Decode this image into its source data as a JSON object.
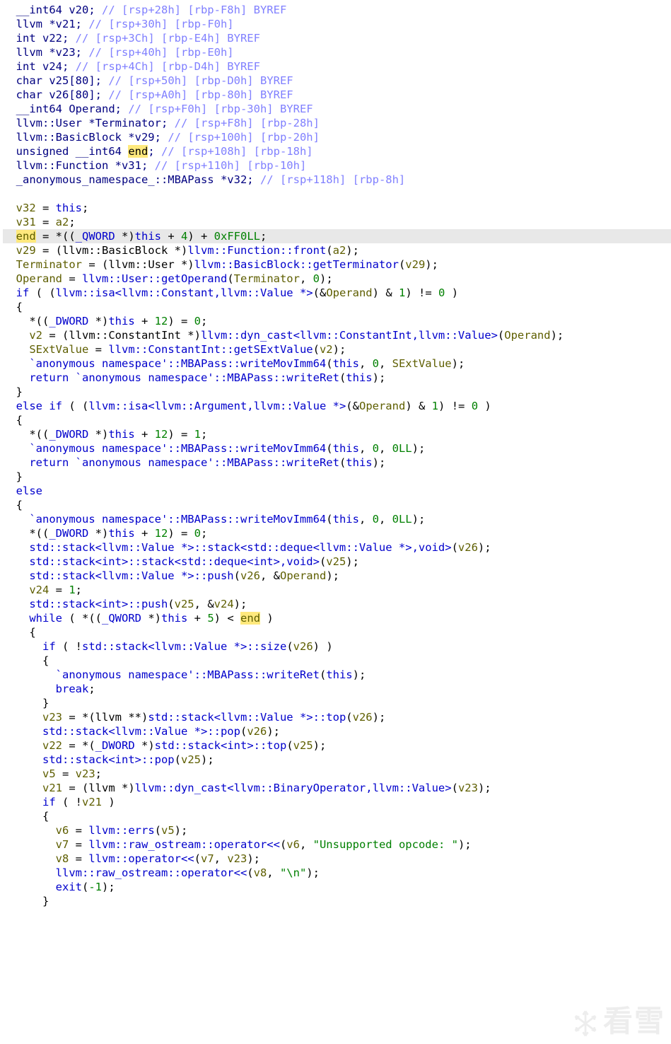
{
  "decl": {
    "v20": "__int64 v20;",
    "v20c": "// [rsp+28h] [rbp-F8h] BYREF",
    "v21": "llvm *v21;",
    "v21c": "// [rsp+30h] [rbp-F0h]",
    "v22": "int v22;",
    "v22c": "// [rsp+3Ch] [rbp-E4h] BYREF",
    "v23": "llvm *v23;",
    "v23c": "// [rsp+40h] [rbp-E0h]",
    "v24": "int v24;",
    "v24c": "// [rsp+4Ch] [rbp-D4h] BYREF",
    "v25": "char v25[80];",
    "v25c": "// [rsp+50h] [rbp-D0h] BYREF",
    "v26": "char v26[80];",
    "v26c": "// [rsp+A0h] [rbp-80h] BYREF",
    "op": "__int64 Operand;",
    "opc": "// [rsp+F0h] [rbp-30h] BYREF",
    "tm": "llvm::User *Terminator;",
    "tmc": "// [rsp+F8h] [rbp-28h]",
    "v29": "llvm::BasicBlock *v29;",
    "v29c": "// [rsp+100h] [rbp-20h]",
    "end": "unsigned __int64 ",
    "endv": "end",
    "end2": ";",
    "endc": "// [rsp+108h] [rbp-18h]",
    "v31": "llvm::Function *v31;",
    "v31c": "// [rsp+110h] [rbp-10h]",
    "v32": "_anonymous_namespace_::MBAPass *v32;",
    "v32c": "// [rsp+118h] [rbp-8h]"
  },
  "c": {
    "v32a": "v32",
    "eq": " = ",
    "this": "this",
    "semi": ";",
    "v31a": "v31",
    "a2": "a2",
    "enda": "end",
    "endexpr1": " = *((",
    "qw": "_QWORD",
    "endexpr2": " *)",
    "endexpr3": " + ",
    "four": "4",
    "endexpr4": ") + ",
    "ff0": "0xFF0LL",
    "v29a": "v29",
    "bb": " = (llvm::BasicBlock *)",
    "front": "llvm::Function::front",
    "lp": "(",
    "rp": ")",
    "tma": "Terminator",
    "usr": " = (llvm::User *)",
    "gett": "llvm::BasicBlock::getTerminator",
    "opa": "Operand",
    "geto": "llvm::User::getOperand",
    "c0": "0",
    "if": "if",
    "sp": " ",
    "isac": "llvm::isa<llvm::Constant,llvm::Value *>",
    "amp": "&",
    "one": "1",
    "ne": "!= ",
    "zero": "0",
    "lb": "{",
    "rb": "}",
    "dw": "_DWORD",
    "twelve": "12",
    "v2": "v2",
    "ci": " = (llvm::ConstantInt *)",
    "dcast": "llvm::dyn_cast<llvm::ConstantInt,llvm::Value>",
    "sext": "SExtValue",
    "gse": "llvm::ConstantInt::getSExtValue",
    "mba1": "`anonymous namespace'::MBAPass::writeMovImm64",
    "ret": "return",
    "mbar": "`anonymous namespace'::MBAPass::writeRet",
    "else": "else",
    "isaa": "llvm::isa<llvm::Argument,llvm::Value *>",
    "oll": "0LL",
    "stkv": "std::stack<llvm::Value *>::stack<std::deque<llvm::Value *>,void>",
    "stki": "std::stack<int>::stack<std::deque<int>,void>",
    "pushv": "std::stack<llvm::Value *>::push",
    "pushi": "std::stack<int>::push",
    "v24a": "v24",
    "v25a": "v25",
    "v26a": "v26",
    "while": "while",
    "five": "5",
    "lt": "<",
    "sizev": "std::stack<llvm::Value *>::size",
    "not": "!",
    "break": "break",
    "v23a": "v23",
    "llvmpp": " = *(llvm **)",
    "topv": "std::stack<llvm::Value *>::top",
    "popv": "std::stack<llvm::Value *>::pop",
    "v22a": "v22",
    "dwp": " = *(",
    "dwp2": " *)",
    "topi": "std::stack<int>::top",
    "popi": "std::stack<int>::pop",
    "v5": "v5",
    "v21a": "v21",
    "llvmp": " = (llvm *)",
    "dcastb": "llvm::dyn_cast<llvm::BinaryOperator,llvm::Value>",
    "v6": "v6",
    "errs": "llvm::errs",
    "v7": "v7",
    "opr": "llvm::raw_ostream::operator<<",
    "str1": "\"Unsupported opcode: \"",
    "v8": "v8",
    "oprl": "llvm::operator<<",
    "str2": "\"\\n\"",
    "exit": "exit",
    "m1": "-1"
  },
  "wm": "看雪"
}
